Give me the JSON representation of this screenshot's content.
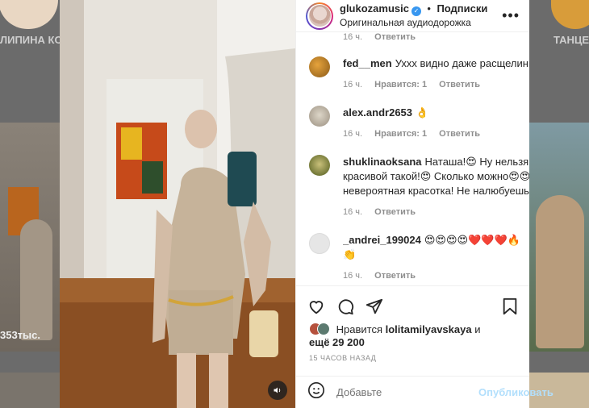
{
  "background": {
    "left_story_label": "ЛИПИНА КО...",
    "right_story_label": "ТАНЦЕ",
    "left_views": "353тыс."
  },
  "post": {
    "username": "glukozamusic",
    "separator": "•",
    "follow_label": "Подписки",
    "audio_label": "Оригинальная аудиодорожка",
    "more_icon": "more-horizontal-icon",
    "sound_icon": "volume-icon"
  },
  "comments": {
    "top_meta": {
      "time": "16 ч.",
      "reply": "Ответить"
    },
    "items": [
      {
        "user": "fed__men",
        "text": "Ухxx видно даже расщелины👏",
        "time": "16 ч.",
        "likes": "Нравится: 1",
        "reply": "Ответить",
        "avatar_color": "#c48a2a"
      },
      {
        "user": "alex.andr2653",
        "text": "👌",
        "time": "16 ч.",
        "likes": "Нравится: 1",
        "reply": "Ответить",
        "avatar_color": "#b8b0a3"
      },
      {
        "user": "shuklinaoksana",
        "text": "Наташа!😍 Ну нельзя ж",
        "text2": "красивой такой!😍 Сколько можно😍😍",
        "text3": "невероятная красотка! Не налюбуешься",
        "time": "16 ч.",
        "likes": "",
        "reply": "Ответить",
        "avatar_color": "#6b7a2c"
      },
      {
        "user": "_andrei_199024",
        "text": "😍😍😍😍❤️❤️❤️🔥",
        "text2": "👏",
        "time": "16 ч.",
        "likes": "",
        "reply": "Ответить",
        "avatar_color": "#dbdbdb"
      }
    ]
  },
  "actions": {
    "like_icon": "heart-icon",
    "comment_icon": "comment-icon",
    "share_icon": "share-icon",
    "save_icon": "bookmark-icon"
  },
  "likes": {
    "prefix": "Нравится",
    "user": "lolitamilyavskaya",
    "conj": "и",
    "more": "ещё 29 200"
  },
  "timestamp": "15 ЧАСОВ НАЗАД",
  "add_comment": {
    "emoji_icon": "emoji-icon",
    "placeholder": "Добавьте",
    "post_label": "Опубликовать"
  },
  "colors": {
    "link_disabled": "#b2dffc",
    "verified": "#3897f0",
    "muted": "#8e8e8e"
  }
}
